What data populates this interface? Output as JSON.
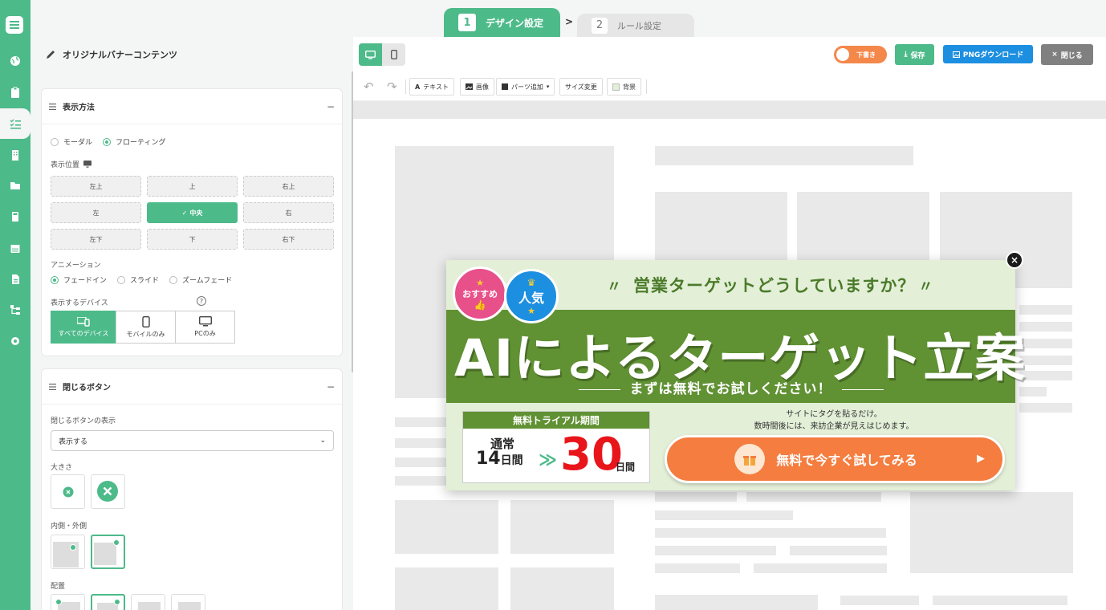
{
  "steps": {
    "step1_num": "1",
    "step1_label": "デザイン設定",
    "separator": ">",
    "step2_num": "2",
    "step2_label": "ルール設定"
  },
  "panel": {
    "title": "オリジナルバナーコンテンツ",
    "display": {
      "header": "表示方法",
      "collapse": "−",
      "mode_modal": "モーダル",
      "mode_floating": "フローティング",
      "position_label": "表示位置",
      "positions": [
        "左上",
        "上",
        "右上",
        "左",
        "中央",
        "右",
        "左下",
        "下",
        "右下"
      ],
      "animation_label": "アニメーション",
      "anim_fade": "フェードイン",
      "anim_slide": "スライド",
      "anim_zoom": "ズームフェード",
      "device_label": "表示するデバイス",
      "help": "?",
      "dev_all": "すべてのデバイス",
      "dev_mobile": "モバイルのみ",
      "dev_pc": "PCのみ"
    },
    "close": {
      "header": "閉じるボタン",
      "collapse": "−",
      "display_label": "閉じるボタンの表示",
      "display_value": "表示する",
      "size_label": "大きさ",
      "inout_label": "内側・外側",
      "placement_label": "配置"
    }
  },
  "toolbar": {
    "draft_label": "下書き",
    "save_label": "保存",
    "png_label": "PNGダウンロード",
    "close_label": "閉じる",
    "text_label": "テキスト",
    "image_label": "画像",
    "parts_label": "パーツ追加",
    "resize_label": "サイズ変更",
    "bg_label": "背景"
  },
  "banner": {
    "badge_recommend": "おすすめ",
    "badge_popular": "人気",
    "headline": "営業ターゲットどうしていますか？",
    "main": "AIによるターゲット立案",
    "sub": "まずは無料でお試しください！",
    "trial_header": "無料トライアル期間",
    "normal_label": "通常",
    "normal_days": "14",
    "days_unit": "日間",
    "arrow": "≫",
    "trial_days": "30",
    "note_line1": "サイトにタグを貼るだけ。",
    "note_line2": "数時間後には、来訪企業が見えはじめます。",
    "cta": "無料で今すぐ試してみる",
    "close": "×"
  },
  "colors": {
    "accent": "#4dba8a",
    "orange": "#f47d3f",
    "blue": "#1d8fe1",
    "gray": "#808080",
    "banner_green": "#609133"
  }
}
